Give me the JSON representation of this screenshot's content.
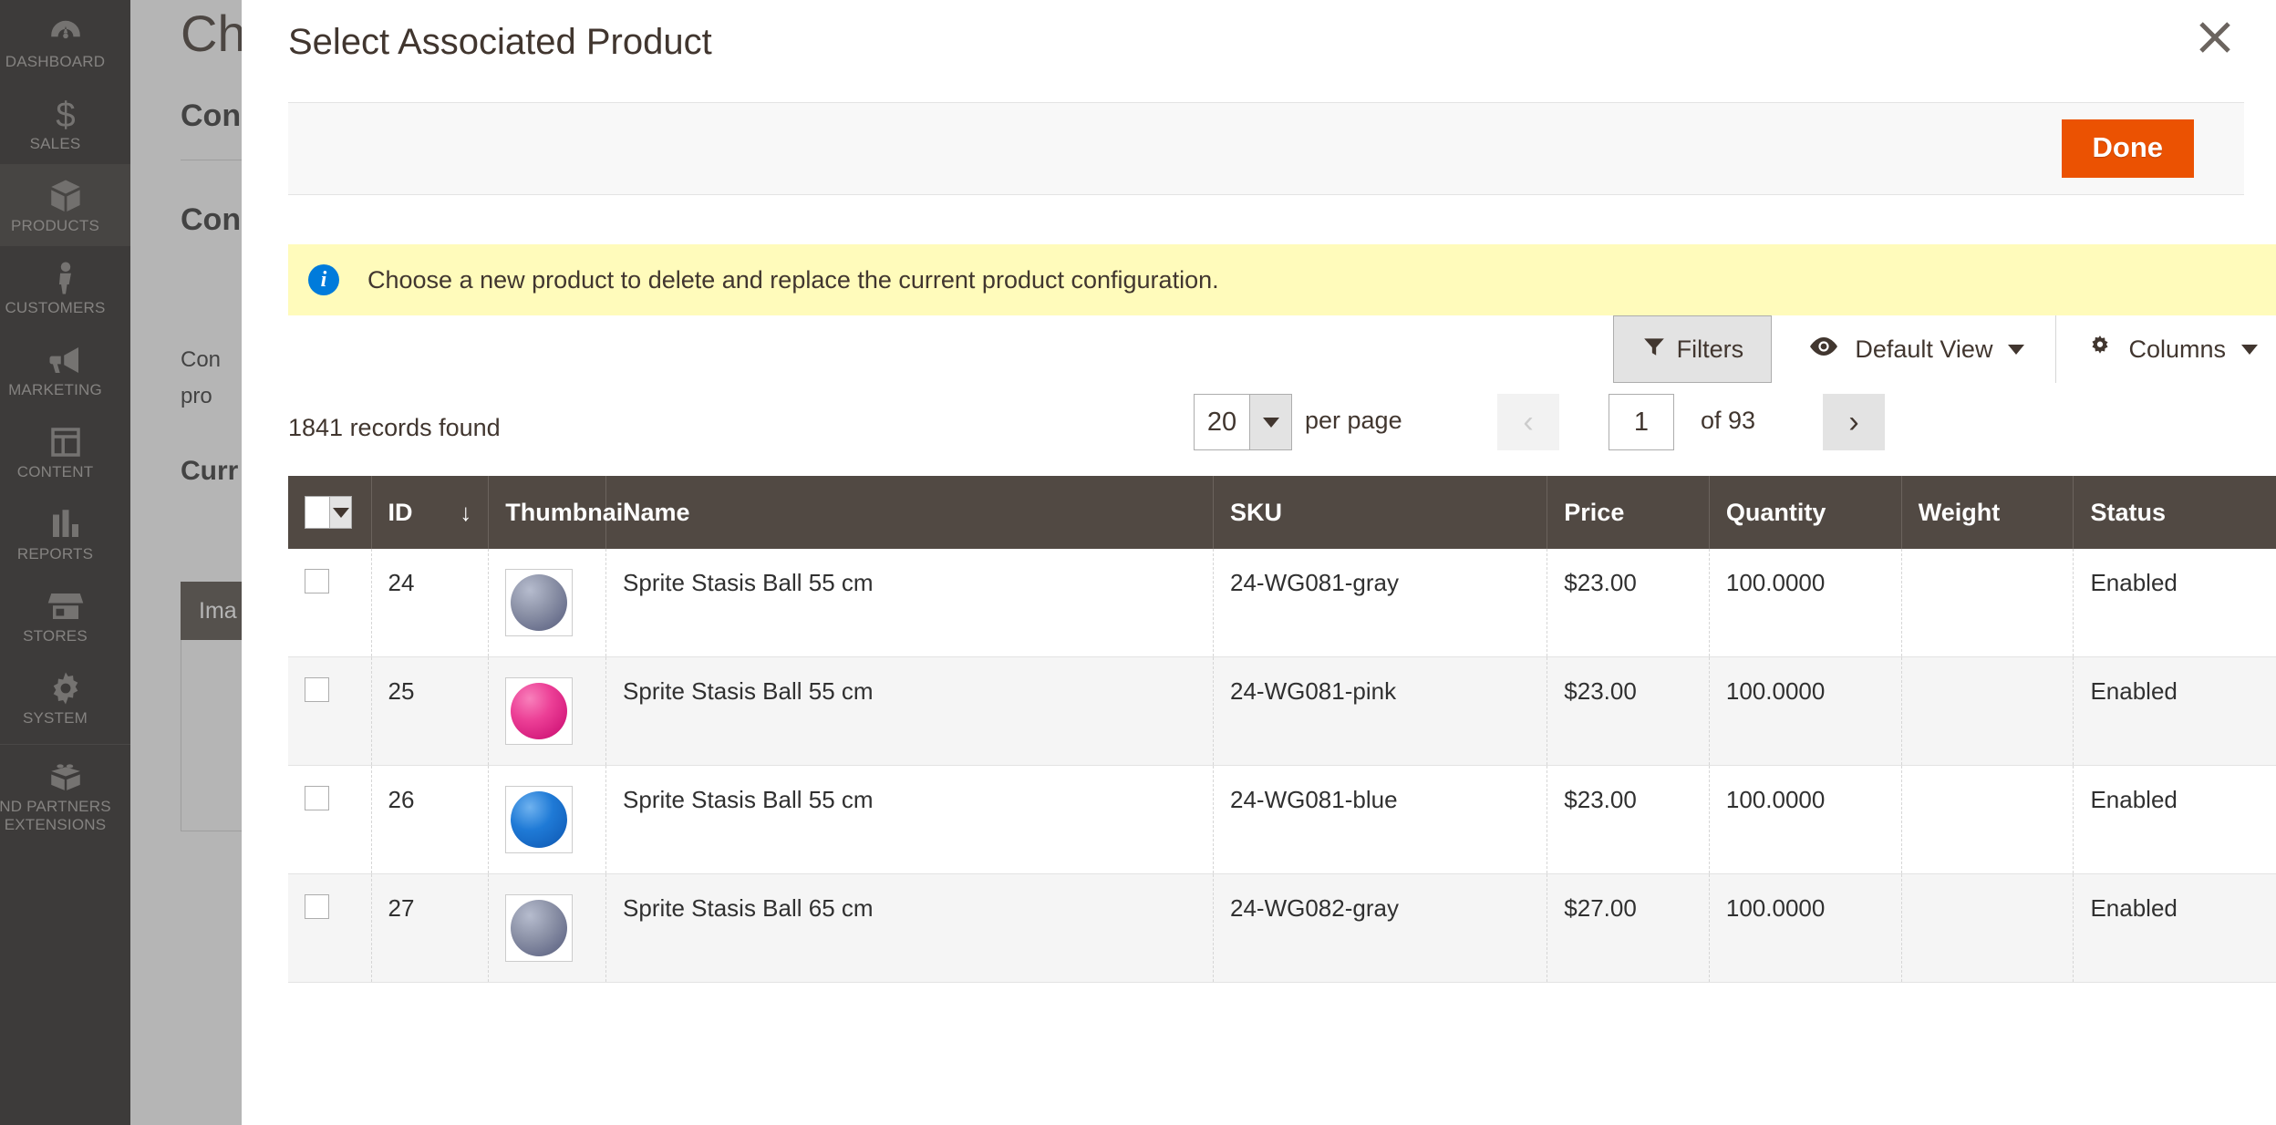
{
  "sidebar": {
    "items": [
      {
        "label": "DASHBOARD",
        "icon": "dashboard-icon",
        "active": false
      },
      {
        "label": "SALES",
        "icon": "dollar-icon",
        "active": false
      },
      {
        "label": "PRODUCTS",
        "icon": "box-icon",
        "active": true
      },
      {
        "label": "CUSTOMERS",
        "icon": "person-icon",
        "active": false
      },
      {
        "label": "MARKETING",
        "icon": "megaphone-icon",
        "active": false
      },
      {
        "label": "CONTENT",
        "icon": "layout-icon",
        "active": false
      },
      {
        "label": "REPORTS",
        "icon": "bar-chart-icon",
        "active": false
      },
      {
        "label": "STORES",
        "icon": "storefront-icon",
        "active": false
      },
      {
        "label": "SYSTEM",
        "icon": "gear-icon",
        "active": false
      },
      {
        "label": "FIND PARTNERS\n& EXTENSIONS",
        "icon": "lego-brick-icon",
        "active": false
      }
    ],
    "partners_line1": "ND PARTNERS",
    "partners_line2": "EXTENSIONS"
  },
  "background": {
    "page_title": "Cha",
    "section_1": "Con",
    "section_2": "Con",
    "paragraph": "Con\npro",
    "section_3": "Curr",
    "table_header": "Ima"
  },
  "modal": {
    "title": "Select Associated Product",
    "close_icon": "close-icon",
    "done_label": "Done",
    "done_color": "#eb5202"
  },
  "notice": {
    "icon": "info-icon",
    "icon_glyph": "i",
    "text": "Choose a new product to delete and replace the current product configuration.",
    "background": "#fffbbb",
    "icon_color": "#007bdb"
  },
  "toolbar": {
    "filters_label": "Filters",
    "filters_icon": "funnel-icon",
    "view_label": "Default View",
    "view_icon": "eye-icon",
    "columns_label": "Columns",
    "columns_icon": "gear-icon"
  },
  "pagination": {
    "records_found": "1841 records found",
    "per_page_value": "20",
    "per_page_label": "per page",
    "prev_icon": "chevron-left-icon",
    "next_icon": "chevron-right-icon",
    "prev_glyph": "‹",
    "next_glyph": "›",
    "current_page": "1",
    "of_pages": "of 93"
  },
  "grid": {
    "columns": [
      {
        "key": "checkbox",
        "label": ""
      },
      {
        "key": "id",
        "label": "ID",
        "sorted": true,
        "sort_glyph": "↓"
      },
      {
        "key": "thumbnail",
        "label": "Thumbnail"
      },
      {
        "key": "name",
        "label": "Name"
      },
      {
        "key": "sku",
        "label": "SKU"
      },
      {
        "key": "price",
        "label": "Price"
      },
      {
        "key": "quantity",
        "label": "Quantity"
      },
      {
        "key": "weight",
        "label": "Weight"
      },
      {
        "key": "status",
        "label": "Status"
      }
    ],
    "rows": [
      {
        "id": "24",
        "thumb": "ball-gray",
        "name": "Sprite Stasis Ball 55 cm",
        "sku": "24-WG081-gray",
        "price": "$23.00",
        "quantity": "100.0000",
        "weight": "",
        "status": "Enabled"
      },
      {
        "id": "25",
        "thumb": "ball-pink",
        "name": "Sprite Stasis Ball 55 cm",
        "sku": "24-WG081-pink",
        "price": "$23.00",
        "quantity": "100.0000",
        "weight": "",
        "status": "Enabled"
      },
      {
        "id": "26",
        "thumb": "ball-blue",
        "name": "Sprite Stasis Ball 55 cm",
        "sku": "24-WG081-blue",
        "price": "$23.00",
        "quantity": "100.0000",
        "weight": "",
        "status": "Enabled"
      },
      {
        "id": "27",
        "thumb": "ball-gray",
        "name": "Sprite Stasis Ball 65 cm",
        "sku": "24-WG082-gray",
        "price": "$27.00",
        "quantity": "100.0000",
        "weight": "",
        "status": "Enabled"
      }
    ]
  }
}
